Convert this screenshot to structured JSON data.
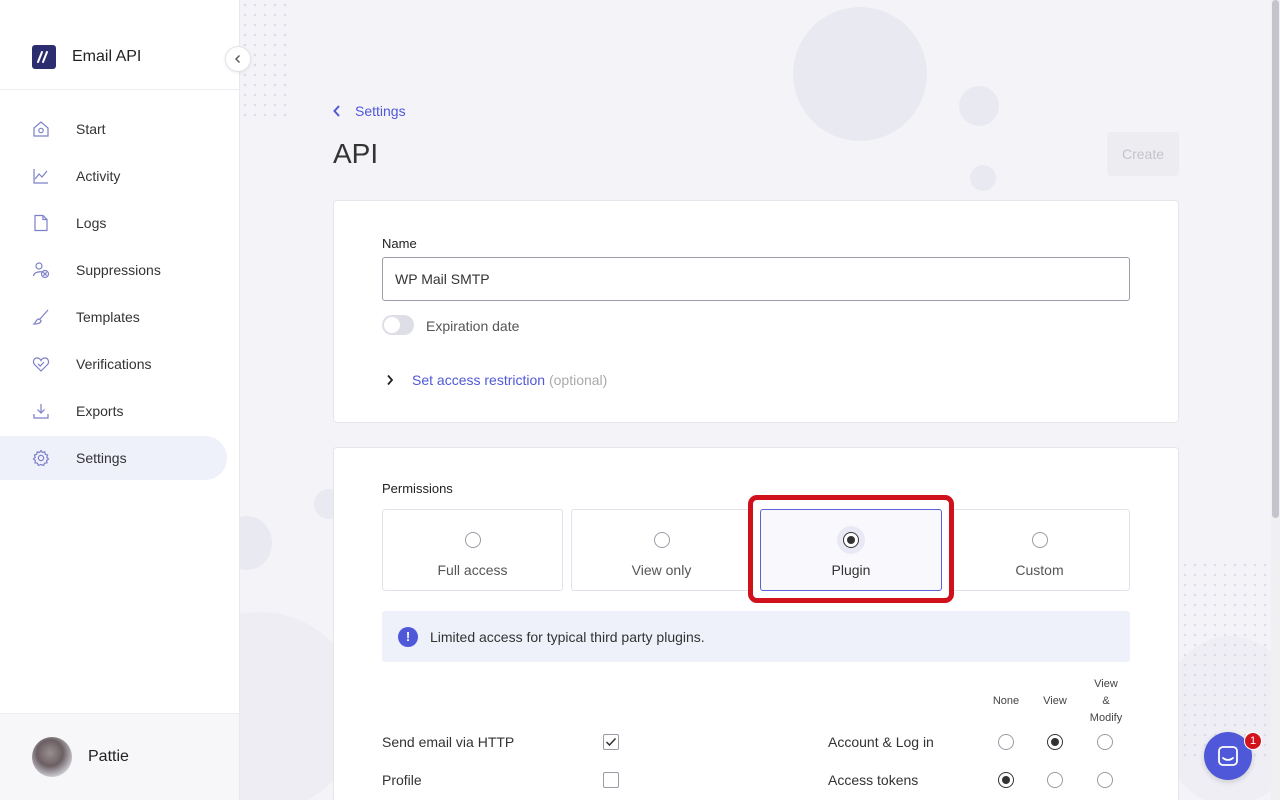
{
  "app": {
    "name": "Email API"
  },
  "sidebar": {
    "items": [
      {
        "label": "Start",
        "icon": "home-icon",
        "active": false
      },
      {
        "label": "Activity",
        "icon": "activity-chart-icon",
        "active": false
      },
      {
        "label": "Logs",
        "icon": "document-icon",
        "active": false
      },
      {
        "label": "Suppressions",
        "icon": "user-block-icon",
        "active": false
      },
      {
        "label": "Templates",
        "icon": "brush-icon",
        "active": false
      },
      {
        "label": "Verifications",
        "icon": "heart-check-icon",
        "active": false
      },
      {
        "label": "Exports",
        "icon": "download-icon",
        "active": false
      },
      {
        "label": "Settings",
        "icon": "gear-icon",
        "active": true
      }
    ],
    "user": {
      "name": "Pattie"
    }
  },
  "header": {
    "breadcrumb": "Settings",
    "title": "API",
    "create_label": "Create"
  },
  "details": {
    "name_label": "Name",
    "name_value": "WP Mail SMTP",
    "expiration_label": "Expiration date",
    "expiration_enabled": false,
    "restriction_link": "Set access restriction",
    "restriction_optional": "(optional)"
  },
  "permissions": {
    "label": "Permissions",
    "options": [
      {
        "label": "Full access",
        "selected": false
      },
      {
        "label": "View only",
        "selected": false
      },
      {
        "label": "Plugin",
        "selected": true
      },
      {
        "label": "Custom",
        "selected": false
      }
    ],
    "info_text": "Limited access for typical third party plugins.",
    "columns": {
      "none": "None",
      "view": "View",
      "view_modify_1": "View",
      "view_modify_2": "&",
      "view_modify_3": "Modify"
    },
    "left_rows": [
      {
        "label": "Send email via HTTP",
        "checked": true
      },
      {
        "label": "Profile",
        "checked": false
      }
    ],
    "right_rows": [
      {
        "label": "Account & Log in",
        "value": "view"
      },
      {
        "label": "Access tokens",
        "value": "none"
      }
    ]
  },
  "chat": {
    "badge_count": "1"
  },
  "colors": {
    "accent": "#4f58d8",
    "highlight": "#d0111b",
    "brand": "#2b2d6e"
  }
}
